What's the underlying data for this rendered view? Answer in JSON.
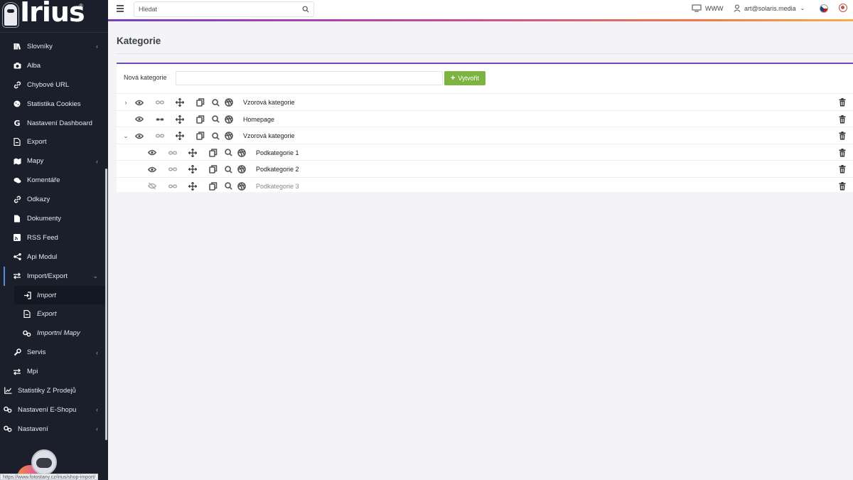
{
  "brand": {
    "logo_text": "Irius",
    "reg": "®"
  },
  "sidebar": {
    "items": [
      {
        "label": "Slovníky",
        "icon": "books-icon",
        "chevron": "‹",
        "level": 1
      },
      {
        "label": "Alba",
        "icon": "camera-icon",
        "level": 1
      },
      {
        "label": "Chybové URL",
        "icon": "link-icon",
        "level": 1
      },
      {
        "label": "Statistika Cookies",
        "icon": "cookie-icon",
        "level": 1
      },
      {
        "label": "Nastavení Dashboard",
        "icon": "google-icon",
        "level": 1
      },
      {
        "label": "Export",
        "icon": "file-export-icon",
        "level": 1
      },
      {
        "label": "Mapy",
        "icon": "map-icon",
        "chevron": "‹",
        "level": 1
      },
      {
        "label": "Komentáře",
        "icon": "comments-icon",
        "level": 1
      },
      {
        "label": "Odkazy",
        "icon": "link-icon",
        "level": 1
      },
      {
        "label": "Dokumenty",
        "icon": "document-icon",
        "level": 1
      },
      {
        "label": "RSS Feed",
        "icon": "rss-icon",
        "level": 1
      },
      {
        "label": "Api Modul",
        "icon": "share-icon",
        "level": 1
      },
      {
        "label": "Import/Export",
        "icon": "exchange-icon",
        "chevron": "⌄",
        "level": 1,
        "expanded": true
      },
      {
        "label": "Import",
        "icon": "sign-in-icon",
        "level": 2,
        "active": true
      },
      {
        "label": "Export",
        "icon": "file-export-icon",
        "level": 2
      },
      {
        "label": "Importní Mapy",
        "icon": "cogs-icon",
        "level": 2
      },
      {
        "label": "Servis",
        "icon": "wrench-icon",
        "chevron": "‹",
        "level": 1
      },
      {
        "label": "Mpi",
        "icon": "exchange-icon",
        "level": 1
      },
      {
        "label": "Statistiky Z Prodejů",
        "icon": "chart-line-icon",
        "level": 0
      },
      {
        "label": "Nastavení E-Shopu",
        "icon": "cogs-icon",
        "chevron": "‹",
        "level": 0
      },
      {
        "label": "Nastavení",
        "icon": "cogs-icon",
        "chevron": "‹",
        "level": 0
      }
    ],
    "status_url": "https://www.fotostany.cz/irius/shop-import/"
  },
  "topbar": {
    "search_placeholder": "Hledat",
    "www_label": "WWW",
    "user_email": "art@solaris.media"
  },
  "page": {
    "title": "Kategorie",
    "new_category_label": "Nová kategorie",
    "new_category_value": "",
    "create_button": "Vytvořit",
    "create_plus": "+"
  },
  "categories": [
    {
      "name": "Vzorová kategorie",
      "toggle": "›",
      "level": 0,
      "visible": true,
      "linked": false
    },
    {
      "name": "Homepage",
      "toggle": "",
      "level": 0,
      "visible": true,
      "linked": true
    },
    {
      "name": "Vzorová kategorie",
      "toggle": "⌄",
      "level": 0,
      "visible": true,
      "linked": false
    },
    {
      "name": "Podkategorie 1",
      "toggle": "",
      "level": 1,
      "visible": true,
      "linked": false
    },
    {
      "name": "Podkategorie 2",
      "toggle": "",
      "level": 1,
      "visible": true,
      "linked": false
    },
    {
      "name": "Podkategorie 3",
      "toggle": "",
      "level": 1,
      "visible": false,
      "linked": false
    }
  ],
  "colors": {
    "sidebar_bg": "#1b1f2b",
    "accent_purple": "#6c4ab6",
    "create_green": "#7cb342"
  }
}
